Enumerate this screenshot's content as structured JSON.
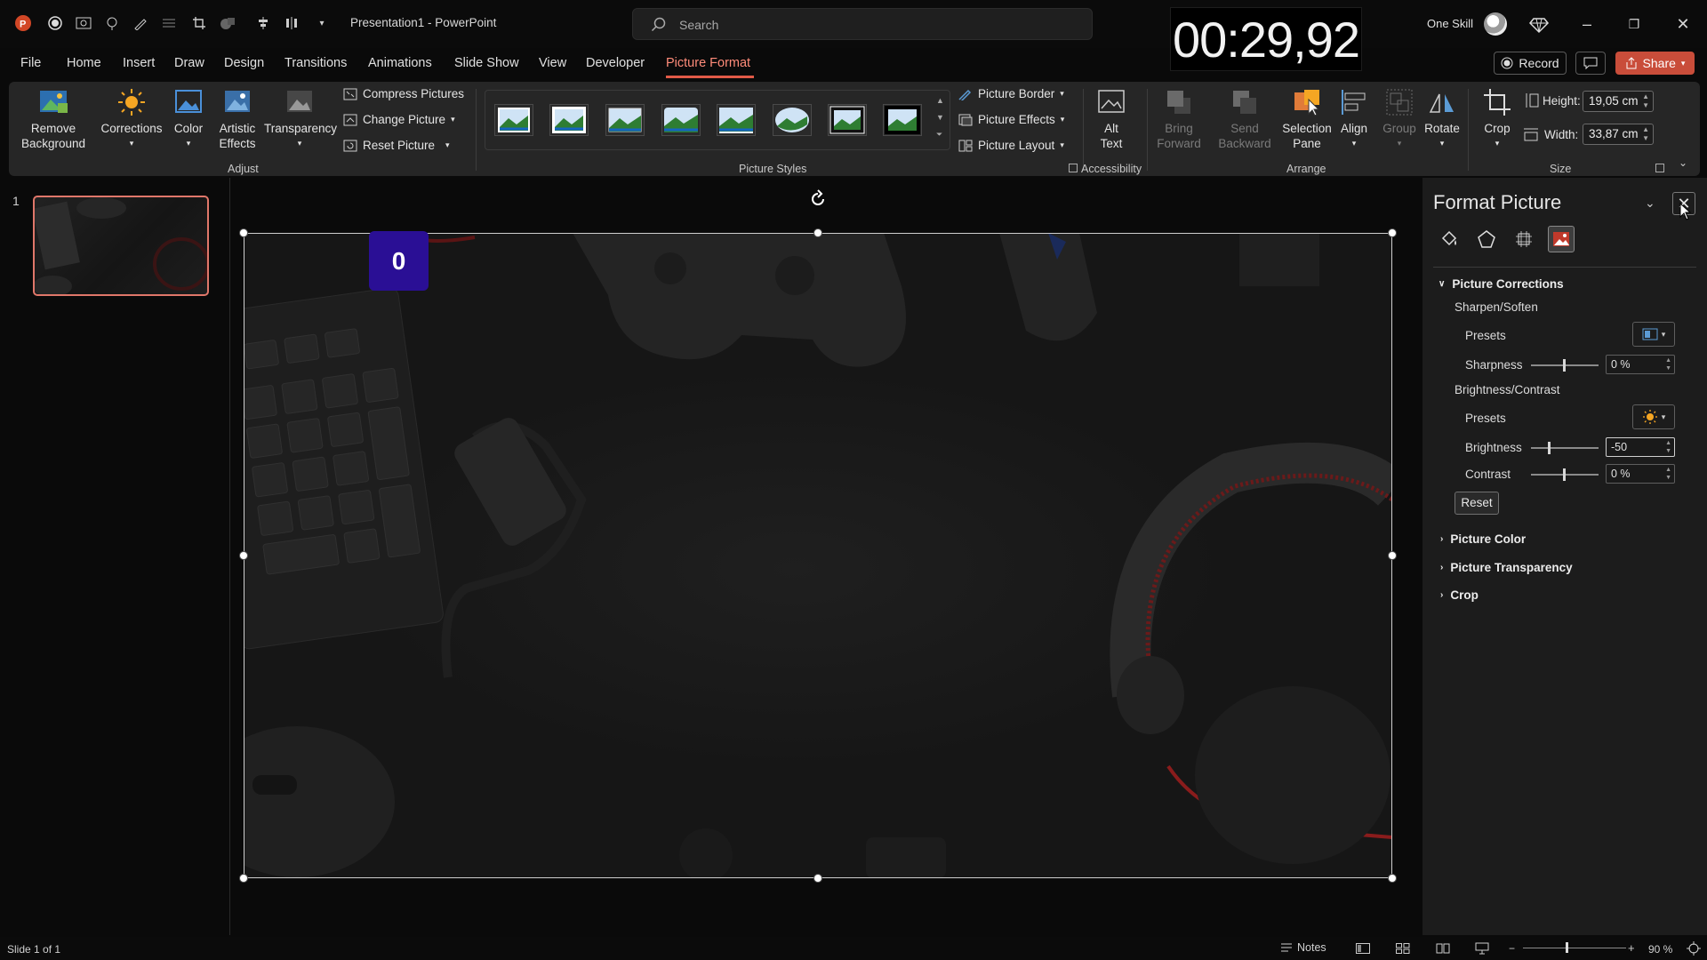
{
  "window": {
    "title": "Presentation1  -  PowerPoint"
  },
  "search": {
    "placeholder": "Search"
  },
  "timer": "00:29,92",
  "user": {
    "name": "One Skill"
  },
  "tabs": [
    "File",
    "Home",
    "Insert",
    "Draw",
    "Design",
    "Transitions",
    "Animations",
    "Slide Show",
    "View",
    "Developer",
    "Picture Format"
  ],
  "active_tab": "Picture Format",
  "top_right": {
    "record": "Record",
    "share": "Share"
  },
  "ribbon": {
    "adjust": {
      "remove_background": [
        "Remove",
        "Background"
      ],
      "corrections": "Corrections",
      "color": "Color",
      "artistic_effects": [
        "Artistic",
        "Effects"
      ],
      "transparency": "Transparency",
      "compress": "Compress Pictures",
      "change_picture": "Change Picture",
      "reset_picture": "Reset Picture",
      "label": "Adjust"
    },
    "styles": {
      "label": "Picture Styles",
      "border": "Picture Border",
      "effects": "Picture Effects",
      "layout": "Picture Layout"
    },
    "accessibility": {
      "alt_text": [
        "Alt",
        "Text"
      ],
      "label": "Accessibility"
    },
    "arrange": {
      "bring_forward": [
        "Bring",
        "Forward"
      ],
      "send_backward": [
        "Send",
        "Backward"
      ],
      "selection_pane": [
        "Selection",
        "Pane"
      ],
      "align": "Align",
      "group": "Group",
      "rotate": "Rotate",
      "label": "Arrange"
    },
    "size": {
      "crop": "Crop",
      "height_label": "Height:",
      "height_value": "19,05 cm",
      "width_label": "Width:",
      "width_value": "33,87 cm",
      "label": "Size"
    }
  },
  "slides_pane": {
    "number": "1"
  },
  "slide": {
    "badge": "0"
  },
  "format_pane": {
    "title": "Format Picture",
    "picture_corrections": "Picture Corrections",
    "sharpen_soften": "Sharpen/Soften",
    "presets": "Presets",
    "sharpness_label": "Sharpness",
    "sharpness_value": "0 %",
    "brightness_contrast": "Brightness/Contrast",
    "presets2": "Presets",
    "brightness_label": "Brightness",
    "brightness_value": "-50",
    "contrast_label": "Contrast",
    "contrast_value": "0 %",
    "reset": "Reset",
    "picture_color": "Picture Color",
    "picture_transparency": "Picture Transparency",
    "crop": "Crop"
  },
  "status": {
    "slide_info": "Slide 1 of 1",
    "notes": "Notes",
    "zoom": "90 %"
  },
  "colors": {
    "accent": "#e15a47",
    "share": "#c94d3a",
    "badge": "#2a0f95"
  }
}
